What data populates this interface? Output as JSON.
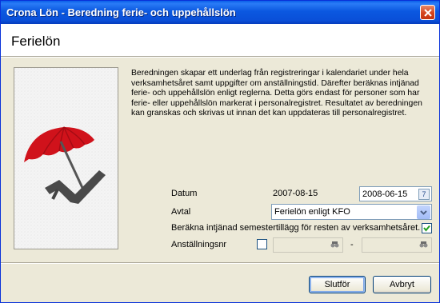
{
  "window": {
    "title": "Crona Lön - Beredning ferie- och uppehållslön"
  },
  "header": {
    "title": "Ferielön"
  },
  "description": "Beredningen skapar ett underlag från registreringar i kalendariet under hela verksamhetsåret samt uppgifter om anställningstid. Därefter beräknas intjänad ferie- och uppehållslön enligt reglerna. Detta görs endast för personer som har ferie- eller uppehållslön markerat i personalregistret. Resultatet av beredningen kan granskas och skrivas ut innan det kan uppdateras till personalregistret.",
  "form": {
    "datum_label": "Datum",
    "datum_value": "2007-08-15",
    "datum_input": "2008-06-15",
    "avtal_label": "Avtal",
    "avtal_selected": "Ferielön enligt KFO",
    "semester_label": "Beräkna intjänad semestertillägg för resten av verksamhetsåret.",
    "semester_checked": true,
    "anstallningsnr_label": "Anställningsnr",
    "anstallningsnr_checked": false,
    "range_separator": "-"
  },
  "buttons": {
    "finish": "Slutför",
    "cancel": "Avbryt"
  },
  "colors": {
    "titlebar": "#0a5fe9",
    "umbrella": "#d0121b",
    "dialog_bg": "#ece9d8"
  }
}
